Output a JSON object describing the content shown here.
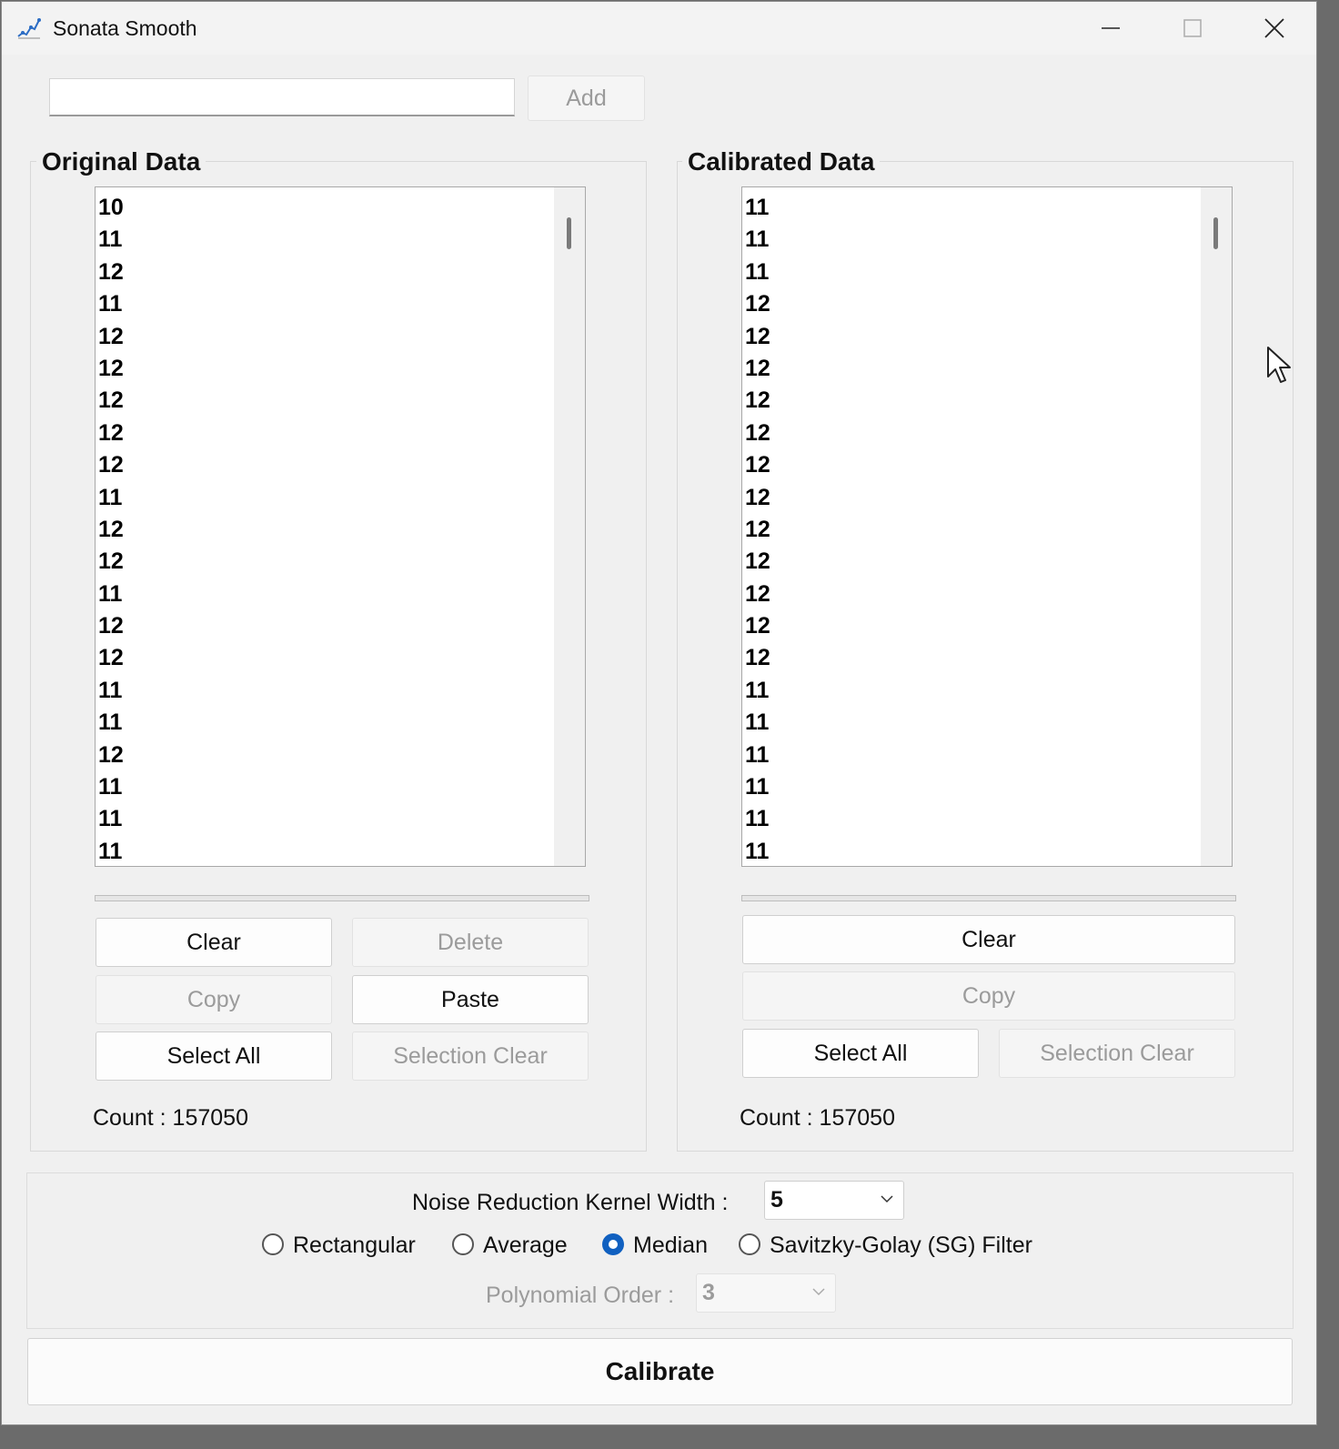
{
  "window": {
    "title": "Sonata Smooth",
    "icon": "chart-line-icon"
  },
  "top_input": {
    "value": "",
    "placeholder": ""
  },
  "add_button": {
    "label": "Add",
    "enabled": false
  },
  "original": {
    "title": "Original Data",
    "items": [
      "10",
      "11",
      "12",
      "11",
      "12",
      "12",
      "12",
      "12",
      "12",
      "11",
      "12",
      "12",
      "11",
      "12",
      "12",
      "11",
      "11",
      "12",
      "11",
      "11",
      "11"
    ],
    "buttons": {
      "clear": "Clear",
      "delete": "Delete",
      "copy": "Copy",
      "paste": "Paste",
      "select_all": "Select All",
      "selection_clear": "Selection Clear"
    },
    "count": "Count : 157050"
  },
  "calibrated": {
    "title": "Calibrated Data",
    "items": [
      "11",
      "11",
      "11",
      "12",
      "12",
      "12",
      "12",
      "12",
      "12",
      "12",
      "12",
      "12",
      "12",
      "12",
      "12",
      "11",
      "11",
      "11",
      "11",
      "11",
      "11"
    ],
    "buttons": {
      "clear": "Clear",
      "copy": "Copy",
      "select_all": "Select All",
      "selection_clear": "Selection Clear"
    },
    "count": "Count : 157050"
  },
  "settings": {
    "kernel_label": "Noise Reduction Kernel Width :",
    "kernel_value": "5",
    "filters": [
      "Rectangular",
      "Average",
      "Median",
      "Savitzky-Golay (SG) Filter"
    ],
    "selected_filter": "Median",
    "poly_label": "Polynomial Order :",
    "poly_value": "3"
  },
  "calibrate_button": {
    "label": "Calibrate"
  },
  "colors": {
    "accent": "#1060c0",
    "window_bg": "#f0f0f0",
    "disabled_text": "#9b9b9b"
  }
}
